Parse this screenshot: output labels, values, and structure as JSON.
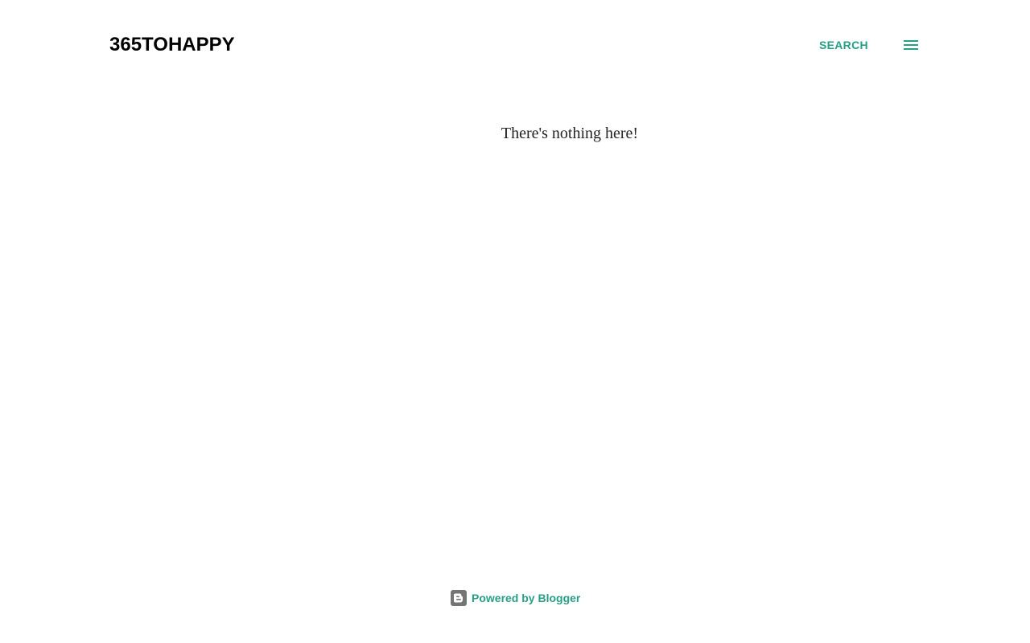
{
  "header": {
    "site_title": "365TOHAPPY",
    "search_label": "SEARCH",
    "menu_icon": "hamburger-menu-icon"
  },
  "main": {
    "empty_message": "There's nothing here!"
  },
  "footer": {
    "powered_by_label": "Powered by Blogger",
    "blogger_icon": "blogger-logo-icon"
  },
  "colors": {
    "accent": "#26a085",
    "title_text": "#000000",
    "body_text": "#212121",
    "background": "#ffffff",
    "icon_gray": "#757575"
  }
}
